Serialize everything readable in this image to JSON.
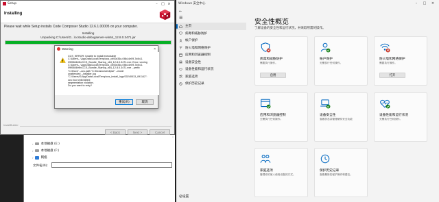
{
  "installer": {
    "titlebar": "Setup",
    "header_title": "Installing",
    "message": "Please wait while Setup installs Code Composer Studio 12.6.1.00005 on your computer.",
    "state": "Installing",
    "unpacking": "Unpacking C:\\Users\\G...\\ccstudio-debugserver-win64_12.8.0.3471.jar",
    "progress_percent": 100,
    "brand": "InstallBuilder",
    "back_label": "< Back",
    "next_label": "Next >",
    "cancel_label": "Cancel"
  },
  "dialog": {
    "title": "Warning",
    "text": "CCS_ERROR: Unable to install executable\nC:\\Users\\...\\AppData\\Local\\Temp\\ccs_cb00d36c-0f8d-4e09-7a9d-1\n09f0584b9b/CCS_Bundle_Startup_x64_12.8.0.3471.exe: Error running\nC:\\Users\\...\\AppData\\Local\\Temp\\ccs_cb00d36c-0f8d-4e09-7a9d-1\n09f0584b9b/CCS_Bundle_Startup_x64_12.8.0.3471.exe --prefix\n\"C:/ti/ccs\" --ccs.path \"C:/ti/ccs/ccs/eclipse\" --mode\nunattended --installer-log\n\"C:/Users/G/AppData/Local/Temp\\ccs_install_logs/20240513_091142\": ccs::tour child killed:\nsegmentation violation.\nDo you want to retry?",
    "retry_label": "重试(R)",
    "cancel_label": "取消"
  },
  "explorer": {
    "tree": [
      {
        "label": "本地磁盘 (E:)",
        "icon": "drive-icon"
      },
      {
        "label": "本地磁盘 (F:)",
        "icon": "drive-icon"
      },
      {
        "label": "网络",
        "icon": "network-icon"
      }
    ],
    "filename_label": "文件名(N):"
  },
  "security": {
    "window_title": "Windows 安全中心",
    "back": "←",
    "menu": "☰",
    "page_title": "安全性概览",
    "subtitle": "了解设备的安全性和运行状况，并采取所需的操作。",
    "nav": [
      {
        "label": "主页",
        "icon": "home-icon",
        "active": true
      },
      {
        "label": "病毒和威胁防护",
        "icon": "shield-icon",
        "active": false
      },
      {
        "label": "帐户保护",
        "icon": "person-icon",
        "active": false
      },
      {
        "label": "防火墙和网络保护",
        "icon": "wifi-icon",
        "active": false
      },
      {
        "label": "应用和浏览器控制",
        "icon": "app-icon",
        "active": false
      },
      {
        "label": "设备安全性",
        "icon": "laptop-icon",
        "active": false
      },
      {
        "label": "设备性能和运行状况",
        "icon": "heart-icon",
        "active": false
      },
      {
        "label": "家庭选项",
        "icon": "family-icon",
        "active": false
      },
      {
        "label": "保护历史记录",
        "icon": "history-icon",
        "active": false
      }
    ],
    "settings_label": "设置",
    "cards": [
      {
        "title": "病毒和威胁防护",
        "desc": "需要执行操作。",
        "button": "启用",
        "icon": "virus-shield-icon",
        "status": "error"
      },
      {
        "title": "帐户保护",
        "desc": "无需执行任何操作。",
        "button": "",
        "icon": "account-icon",
        "status": "ok"
      },
      {
        "title": "防火墙和网络保护",
        "desc": "需要执行操作。",
        "button": "打开",
        "icon": "firewall-icon",
        "status": "error"
      },
      {
        "title": "应用和浏览器控制",
        "desc": "无需执行任何操作。",
        "button": "",
        "icon": "app-control-icon",
        "status": "ok"
      },
      {
        "title": "设备安全性",
        "desc": "查看状态并管理硬件安全功能",
        "button": "",
        "icon": "device-security-icon",
        "status": "ok"
      },
      {
        "title": "设备性能和运行状况",
        "desc": "无需执行任何操作。",
        "button": "",
        "icon": "health-icon",
        "status": "ok"
      },
      {
        "title": "家庭选项",
        "desc": "管理你的家人使用设备的方式。",
        "button": "",
        "icon": "family-icon",
        "status": "none"
      },
      {
        "title": "保护历史记录",
        "desc": "查看最新的保护操作和建议。",
        "button": "",
        "icon": "history-icon",
        "status": "none"
      }
    ],
    "colors": {
      "accent": "#0067c0",
      "ok": "#107c10",
      "error": "#c42b1c",
      "progress": "#06b025"
    }
  }
}
